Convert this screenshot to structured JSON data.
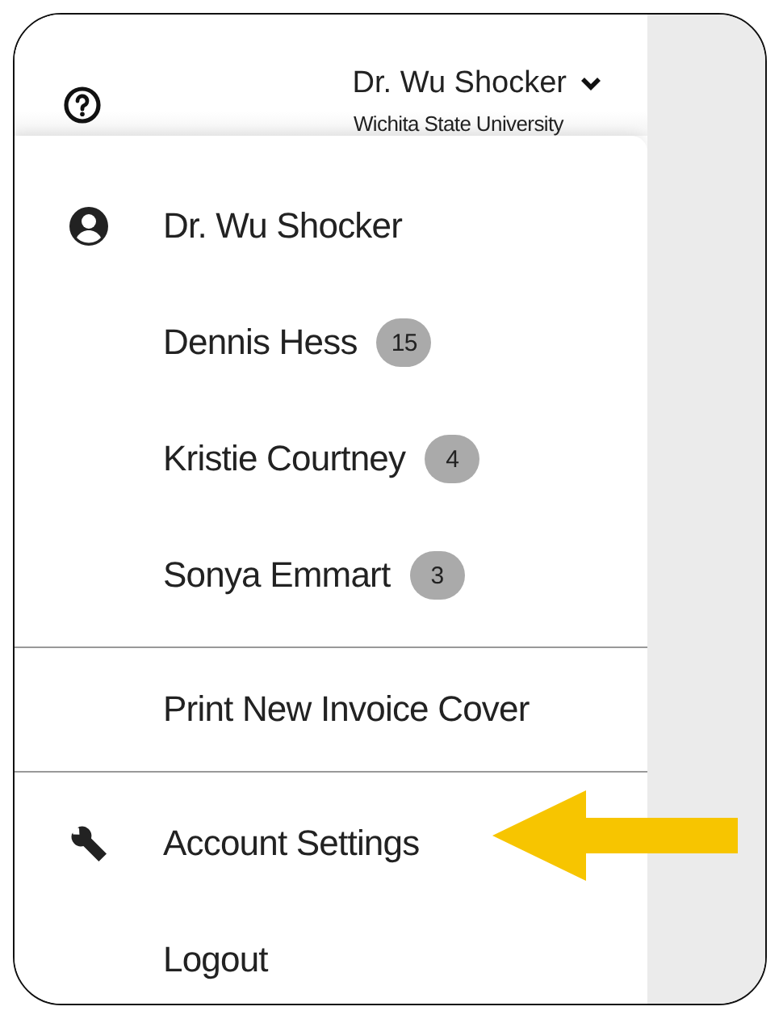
{
  "header": {
    "user_name": "Dr. Wu Shocker",
    "organization": "Wichita State University"
  },
  "menu": {
    "sections": [
      {
        "items": [
          {
            "kind": "profile",
            "label": "Dr. Wu Shocker"
          },
          {
            "kind": "delegate",
            "label": "Dennis Hess",
            "badge": "15"
          },
          {
            "kind": "delegate",
            "label": "Kristie Courtney",
            "badge": "4"
          },
          {
            "kind": "delegate",
            "label": "Sonya Emmart",
            "badge": "3"
          }
        ]
      },
      {
        "items": [
          {
            "kind": "link",
            "label": "Print New Invoice Cover"
          }
        ]
      },
      {
        "items": [
          {
            "kind": "settings",
            "label": "Account Settings"
          },
          {
            "kind": "link",
            "label": "Logout"
          }
        ]
      }
    ]
  }
}
